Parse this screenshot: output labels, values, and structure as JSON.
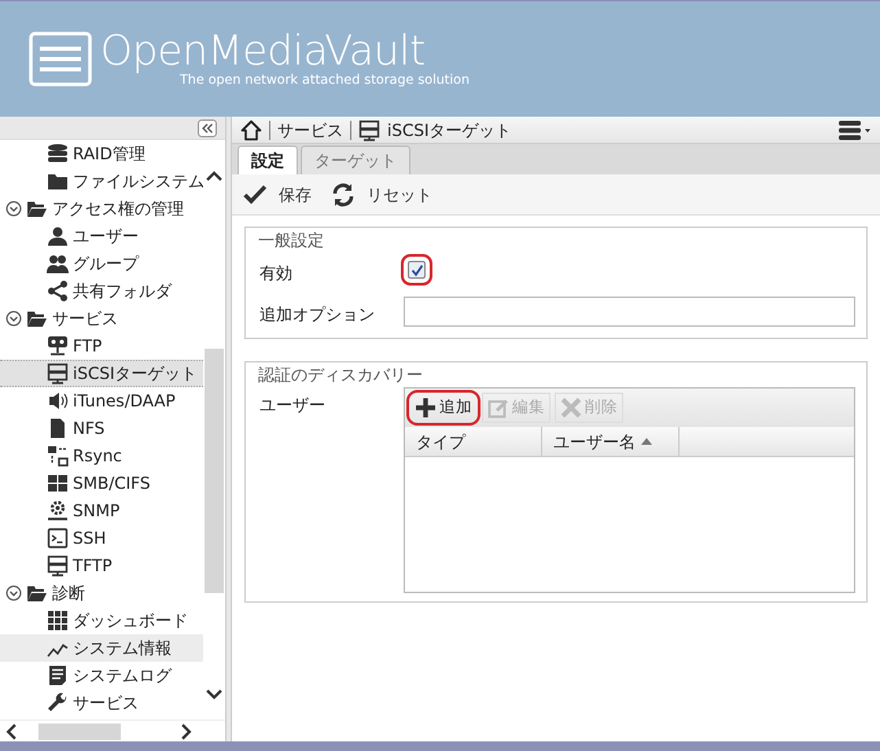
{
  "header": {
    "title": "OpenMediaVault",
    "subtitle": "The open network attached storage solution"
  },
  "sidebar": {
    "tree": [
      {
        "children": [
          {
            "label": "RAID管理",
            "selected": false,
            "hovered": false
          },
          {
            "label": "ファイルシステム",
            "selected": false,
            "hovered": false
          }
        ]
      },
      {
        "label": "アクセス権の管理",
        "expanded": true,
        "children": [
          {
            "label": "ユーザー",
            "selected": false,
            "hovered": false
          },
          {
            "label": "グループ",
            "selected": false,
            "hovered": false
          },
          {
            "label": "共有フォルダ",
            "selected": false,
            "hovered": false
          }
        ]
      },
      {
        "label": "サービス",
        "expanded": true,
        "children": [
          {
            "label": "FTP",
            "selected": false,
            "hovered": false
          },
          {
            "label": "iSCSIターゲット",
            "selected": true,
            "hovered": false
          },
          {
            "label": "iTunes/DAAP",
            "selected": false,
            "hovered": false
          },
          {
            "label": "NFS",
            "selected": false,
            "hovered": false
          },
          {
            "label": "Rsync",
            "selected": false,
            "hovered": false
          },
          {
            "label": "SMB/CIFS",
            "selected": false,
            "hovered": false
          },
          {
            "label": "SNMP",
            "selected": false,
            "hovered": false
          },
          {
            "label": "SSH",
            "selected": false,
            "hovered": false
          },
          {
            "label": "TFTP",
            "selected": false,
            "hovered": false
          }
        ]
      },
      {
        "label": "診断",
        "expanded": true,
        "children": [
          {
            "label": "ダッシュボード",
            "selected": false,
            "hovered": false
          },
          {
            "label": "システム情報",
            "selected": false,
            "hovered": true
          },
          {
            "label": "システムログ",
            "selected": false,
            "hovered": false
          },
          {
            "label": "サービス",
            "selected": false,
            "hovered": false
          }
        ]
      }
    ]
  },
  "breadcrumb": [
    "サービス",
    "iSCSIターゲット"
  ],
  "tabs": [
    {
      "label": "設定",
      "selected": true
    },
    {
      "label": "ターゲット",
      "selected": false
    }
  ],
  "toolbar": [
    "保存",
    "リセット"
  ],
  "sections": [
    {
      "legend": "一般設定",
      "fields": [
        {
          "kind": "checkbox",
          "label": "有効",
          "checked": true,
          "annotated": true
        },
        {
          "kind": "text",
          "label": "追加オプション"
        }
      ]
    },
    {
      "legend": "認証のディスカバリー",
      "fields": [
        {
          "kind": "grid",
          "label": "ユーザー",
          "buttons": [
            {
              "label": "追加",
              "disabled": false,
              "annotated": true
            },
            {
              "label": "編集",
              "disabled": true,
              "annotated": false
            },
            {
              "label": "削除",
              "disabled": true,
              "annotated": false
            }
          ],
          "columns": [
            {
              "label": "タイプ",
              "sorted": false
            },
            {
              "label": "ユーザー名",
              "sorted": true
            }
          ]
        }
      ]
    }
  ]
}
